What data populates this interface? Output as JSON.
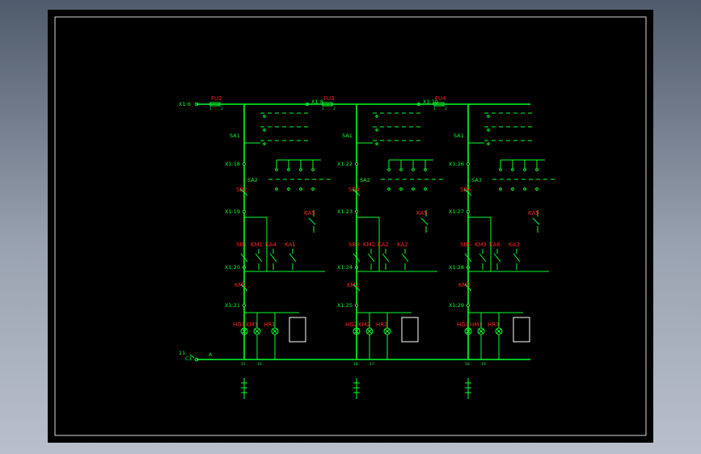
{
  "viewer": {
    "background_color": "#000000",
    "line_color": "#00ff2a",
    "tag_color": "#ff2020"
  },
  "supply": {
    "top_terminal": "X1:6",
    "bottom_terminal": "C1",
    "bottom_terminal_number": "11",
    "neutral_mark": "A"
  },
  "circuits": [
    {
      "fuse": "FU2",
      "feed_terminal": "",
      "selector": "SA1",
      "selector2": "SA2",
      "terminals": [
        "X1:18",
        "X1:19",
        "X1:20",
        "X1:21"
      ],
      "start_button": "SB2",
      "stop_button": "SB1",
      "contacts": [
        "KM1",
        "KA4",
        "KA1",
        "KA5"
      ],
      "coil": "KM1",
      "lamps": [
        "HG1",
        "KM1",
        "HR1"
      ],
      "bottom_numbers": [
        "15",
        "16"
      ]
    },
    {
      "fuse": "FU3",
      "feed_terminal": "X1:8",
      "selector": "SA1",
      "selector2": "SA2",
      "terminals": [
        "X1:22",
        "X1:23",
        "X1:24",
        "X1:25"
      ],
      "start_button": "SB4",
      "stop_button": "SB3",
      "contacts": [
        "KM2",
        "KA2",
        "KA2",
        "KA5"
      ],
      "coil": "KM2",
      "lamps": [
        "HG2",
        "KM2",
        "HR2"
      ],
      "bottom_numbers": [
        "16",
        "17"
      ]
    },
    {
      "fuse": "FU4",
      "feed_terminal": "X1:10",
      "selector": "SA1",
      "selector2": "SA3",
      "terminals": [
        "X1:26",
        "X1:27",
        "X1:28",
        "X1:29"
      ],
      "start_button": "SB6",
      "stop_button": "SB5",
      "contacts": [
        "KM3",
        "KA6",
        "KA3",
        "KA5"
      ],
      "coil": "KM3",
      "lamps": [
        "HG3",
        "HM3",
        "HR3"
      ],
      "bottom_numbers": [
        "18",
        "19"
      ]
    }
  ]
}
